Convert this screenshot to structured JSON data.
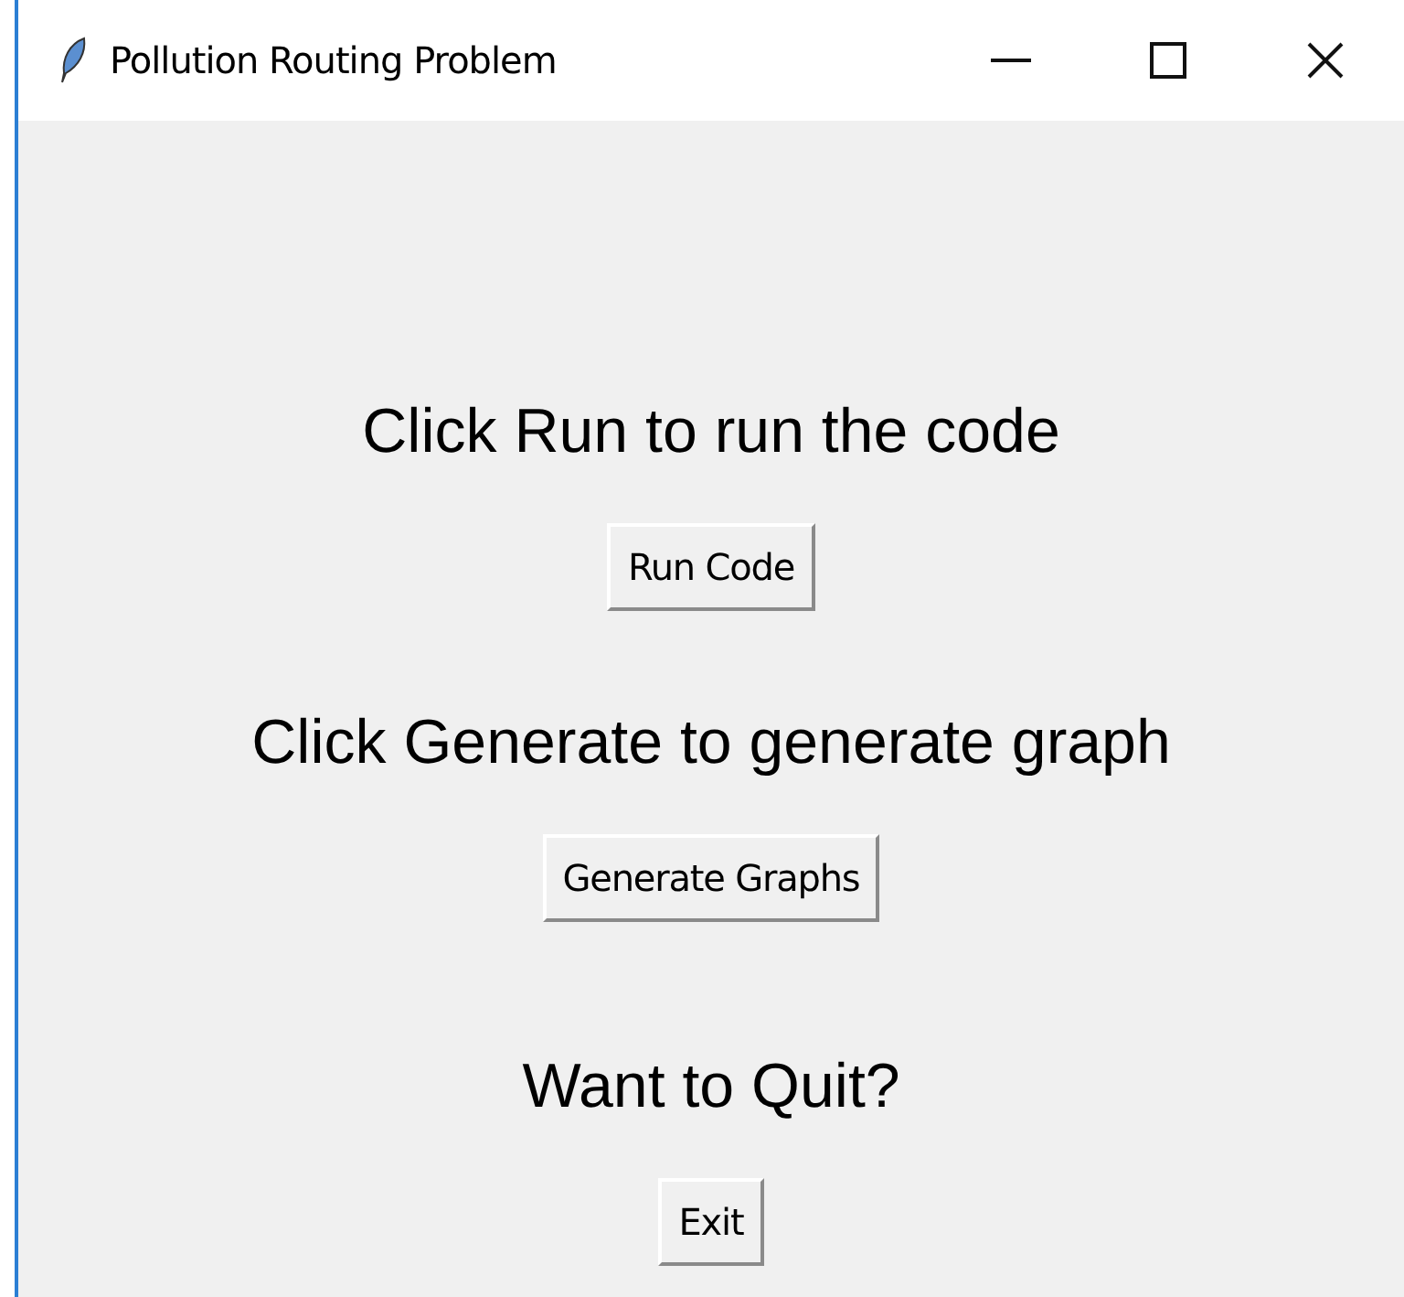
{
  "window": {
    "title": "Pollution Routing Problem"
  },
  "sections": [
    {
      "label": "Click Run to run the code",
      "button": "Run Code"
    },
    {
      "label": "Click Generate to generate graph",
      "button": "Generate Graphs"
    },
    {
      "label": "Want to Quit?",
      "button": "Exit"
    }
  ]
}
